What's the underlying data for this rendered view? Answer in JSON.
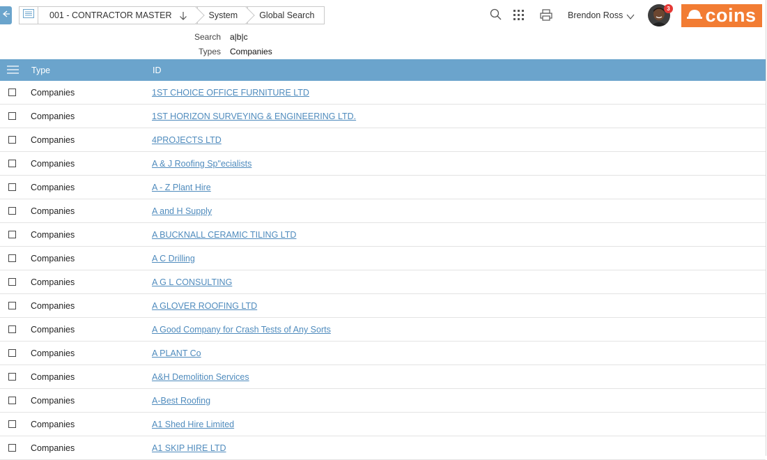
{
  "breadcrumbs": {
    "items": [
      {
        "label": "001 - CONTRACTOR MASTER"
      },
      {
        "label": "System"
      },
      {
        "label": "Global Search"
      }
    ]
  },
  "header": {
    "user_name": "Brendon Ross",
    "notification_count": "3",
    "logo_text": "coins"
  },
  "icons": {
    "back": "arrow-left-icon",
    "menu": "list-icon",
    "sort": "arrow-down-icon",
    "search": "search-icon",
    "apps": "grid-icon",
    "print": "printer-icon",
    "chevron": "chevron-down-icon"
  },
  "colors": {
    "accent": "#6ba4cc",
    "link": "#4f8bbd",
    "brand": "#f27c33",
    "badge": "#e53935"
  },
  "filters": {
    "search_label": "Search",
    "search_value": "a|b|c",
    "types_label": "Types",
    "types_value": "Companies"
  },
  "table": {
    "columns": [
      "Type",
      "ID"
    ],
    "rows": [
      {
        "type": "Companies",
        "id": "1ST CHOICE OFFICE FURNITURE LTD"
      },
      {
        "type": "Companies",
        "id": "1ST HORIZON SURVEYING & ENGINEERING LTD."
      },
      {
        "type": "Companies",
        "id": "4PROJECTS LTD"
      },
      {
        "type": "Companies",
        "id": "A & J Roofing Sp\"ecialists"
      },
      {
        "type": "Companies",
        "id": "A - Z Plant Hire"
      },
      {
        "type": "Companies",
        "id": "A and H Supply"
      },
      {
        "type": "Companies",
        "id": "A BUCKNALL CERAMIC TILING LTD"
      },
      {
        "type": "Companies",
        "id": "A C Drilling"
      },
      {
        "type": "Companies",
        "id": "A G L CONSULTING"
      },
      {
        "type": "Companies",
        "id": "A GLOVER ROOFING LTD"
      },
      {
        "type": "Companies",
        "id": "A Good Company for Crash Tests of Any Sorts"
      },
      {
        "type": "Companies",
        "id": "A PLANT Co"
      },
      {
        "type": "Companies",
        "id": "A&H Demolition Services"
      },
      {
        "type": "Companies",
        "id": "A-Best Roofing"
      },
      {
        "type": "Companies",
        "id": "A1 Shed Hire Limited"
      },
      {
        "type": "Companies",
        "id": "A1 SKIP HIRE LTD"
      }
    ]
  }
}
